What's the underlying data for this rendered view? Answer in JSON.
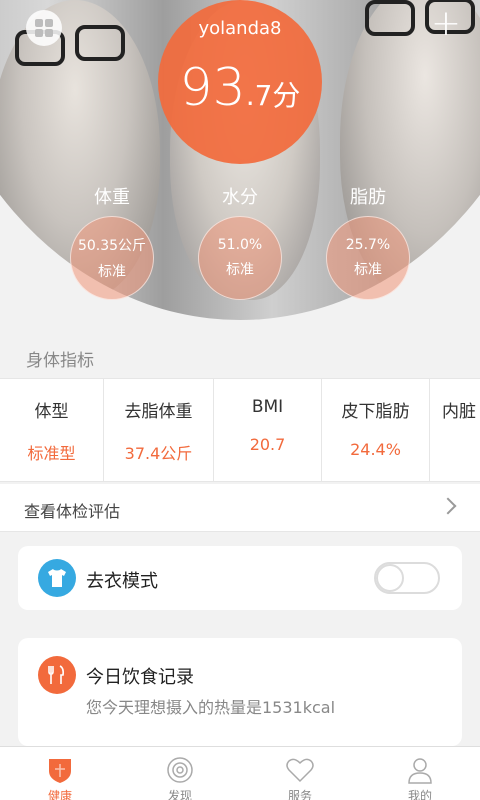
{
  "header": {
    "username": "yolanda8",
    "score_main": "93",
    "score_frac": ".7分",
    "metrics": [
      {
        "label": "体重",
        "value": "50.35公斤",
        "status": "标准"
      },
      {
        "label": "水分",
        "value": "51.0%",
        "status": "标准"
      },
      {
        "label": "脂肪",
        "value": "25.7%",
        "status": "标准"
      }
    ],
    "icons": {
      "menu": "grid-icon",
      "add": "plus-icon"
    }
  },
  "body_index": {
    "title": "身体指标",
    "items": [
      {
        "name": "体型",
        "value": "标准型"
      },
      {
        "name": "去脂体重",
        "value": "37.4公斤"
      },
      {
        "name": "BMI",
        "value": "20.7"
      },
      {
        "name": "皮下脂肪",
        "value": "24.4%"
      },
      {
        "name": "内脏",
        "value": ""
      }
    ]
  },
  "links": {
    "assessment": "查看体检评估"
  },
  "cards": {
    "undress": {
      "title": "去衣模式",
      "toggle_on": false
    },
    "diet": {
      "title": "今日饮食记录",
      "subtitle": "您今天理想摄入的热量是1531kcal"
    }
  },
  "tabbar": [
    {
      "label": "健康",
      "icon": "shield-icon",
      "active": true
    },
    {
      "label": "发现",
      "icon": "target-icon",
      "active": false
    },
    {
      "label": "服务",
      "icon": "heart-icon",
      "active": false
    },
    {
      "label": "我的",
      "icon": "person-icon",
      "active": false
    }
  ],
  "colors": {
    "accent": "#f26a3c",
    "blue": "#36a9e1"
  }
}
